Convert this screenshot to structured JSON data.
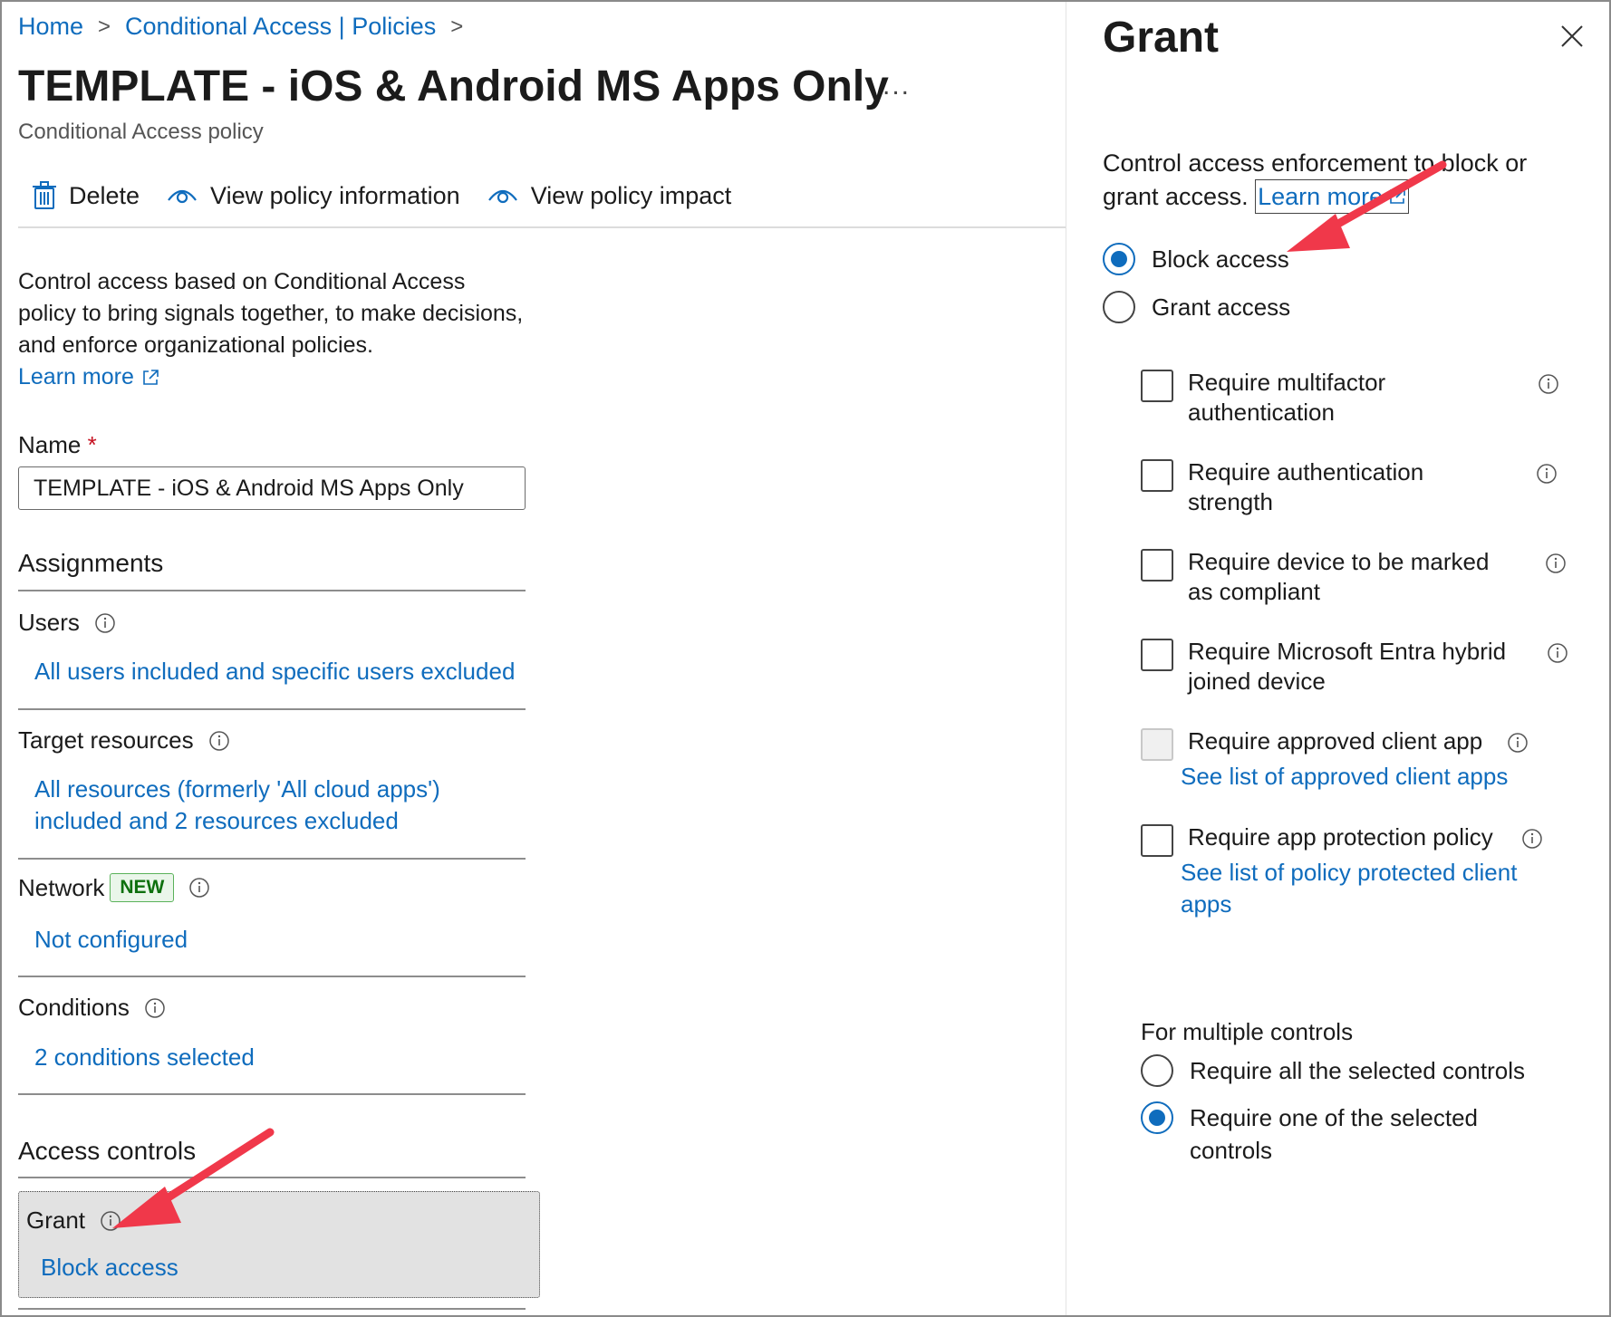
{
  "breadcrumb": {
    "items": [
      "Home",
      "Conditional Access | Policies"
    ],
    "separator": ">"
  },
  "header": {
    "title": "TEMPLATE - iOS & Android MS Apps Only",
    "more": "...",
    "subtitle": "Conditional Access policy"
  },
  "toolbar": {
    "delete_label": "Delete",
    "view_info_label": "View policy information",
    "view_impact_label": "View policy impact"
  },
  "description": {
    "text": "Control access based on Conditional Access policy to bring signals together, to make decisions, and enforce organizational policies.",
    "learn_more": "Learn more"
  },
  "name_field": {
    "label": "Name",
    "required_mark": "*",
    "value": "TEMPLATE - iOS & Android MS Apps Only"
  },
  "assignments": {
    "heading": "Assignments",
    "users": {
      "label": "Users",
      "value": "All users included and specific users excluded"
    },
    "target_resources": {
      "label": "Target resources",
      "value_line1": "All resources (formerly 'All cloud apps')",
      "value_line2": "included and 2 resources excluded"
    },
    "network": {
      "label": "Network",
      "badge": "NEW",
      "value": "Not configured"
    },
    "conditions": {
      "label": "Conditions",
      "value": "2 conditions selected"
    }
  },
  "access_controls": {
    "heading": "Access controls",
    "grant": {
      "label": "Grant",
      "value": "Block access"
    }
  },
  "grant_panel": {
    "title": "Grant",
    "description": "Control access enforcement to block or grant access.",
    "learn_more": "Learn more",
    "options": [
      {
        "label": "Block access",
        "selected": true
      },
      {
        "label": "Grant access",
        "selected": false
      }
    ],
    "controls": [
      {
        "line1": "Require multifactor",
        "line2": "authentication",
        "checked": false
      },
      {
        "line1": "Require authentication",
        "line2": "strength",
        "checked": false
      },
      {
        "line1": "Require device to be marked",
        "line2": "as compliant",
        "checked": false
      },
      {
        "line1": "Require Microsoft Entra hybrid",
        "line2": "joined device",
        "checked": false
      },
      {
        "line1": "Require approved client app",
        "link": "See list of approved client apps",
        "checked": false,
        "disabled": true
      },
      {
        "line1": "Require app protection policy",
        "link_line1": "See list of policy protected client",
        "link_line2": "apps",
        "checked": false
      }
    ],
    "multiple_controls": {
      "label": "For multiple controls",
      "options": [
        {
          "label": "Require all the selected controls",
          "selected": false
        },
        {
          "line1": "Require one of the selected",
          "line2": "controls",
          "selected": true
        }
      ]
    }
  },
  "colors": {
    "link": "#0f6cbd",
    "annotation_arrow": "#f0384a",
    "badge_green": "#0e700e"
  },
  "icons": [
    "chevron-right-icon",
    "trash-icon",
    "eye-icon",
    "external-link-icon",
    "info-icon",
    "close-icon"
  ]
}
